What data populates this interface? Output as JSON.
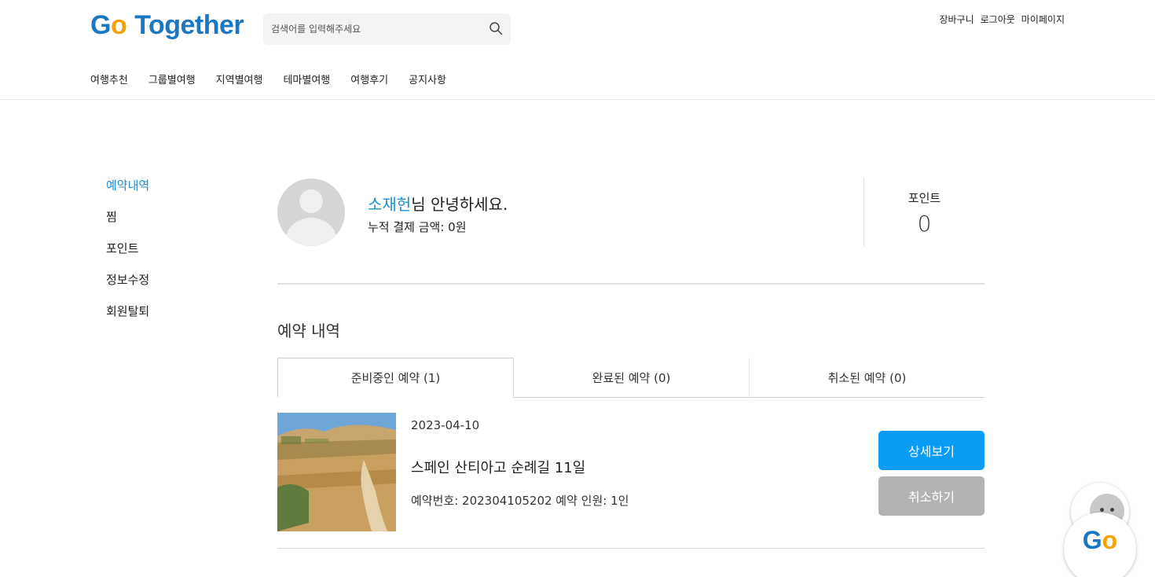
{
  "header": {
    "logo": {
      "g": "G",
      "o": "o",
      "rest": "Together"
    },
    "search": {
      "placeholder": "검색어를 입력해주세요"
    },
    "top_menu": [
      "장바구니",
      "로그아웃",
      "마이페이지"
    ],
    "nav": [
      "여행추천",
      "그룹별여행",
      "지역별여행",
      "테마별여행",
      "여행후기",
      "공지사항"
    ]
  },
  "sidebar": {
    "items": [
      {
        "label": "예약내역",
        "active": true
      },
      {
        "label": "찜"
      },
      {
        "label": "포인트"
      },
      {
        "label": "정보수정"
      },
      {
        "label": "회원탈퇴"
      }
    ]
  },
  "profile": {
    "name": "소재헌",
    "greeting_suffix": "님 안녕하세요.",
    "total_payment": "누적 결제 금액: 0원",
    "point_label": "포인트",
    "point_value": "0"
  },
  "reservations": {
    "title": "예약 내역",
    "tabs": [
      "준비중인 예약 (1)",
      "완료된 예약 (0)",
      "취소된 예약 (0)"
    ],
    "item": {
      "date": "2023-04-10",
      "title": "스페인 산티아고 순례길 11일",
      "info": "예약번호: 202304105202 예약 인원: 1인",
      "detail_button": "상세보기",
      "cancel_button": "취소하기"
    }
  },
  "chatbot": {
    "g": "G",
    "o": "o"
  },
  "colors": {
    "accent": "#1a8fd6",
    "primary_button": "#0a9cf5",
    "secondary_button": "#b3b3b3",
    "logo_blue": "#1a78c2",
    "logo_orange": "#f5a200"
  }
}
